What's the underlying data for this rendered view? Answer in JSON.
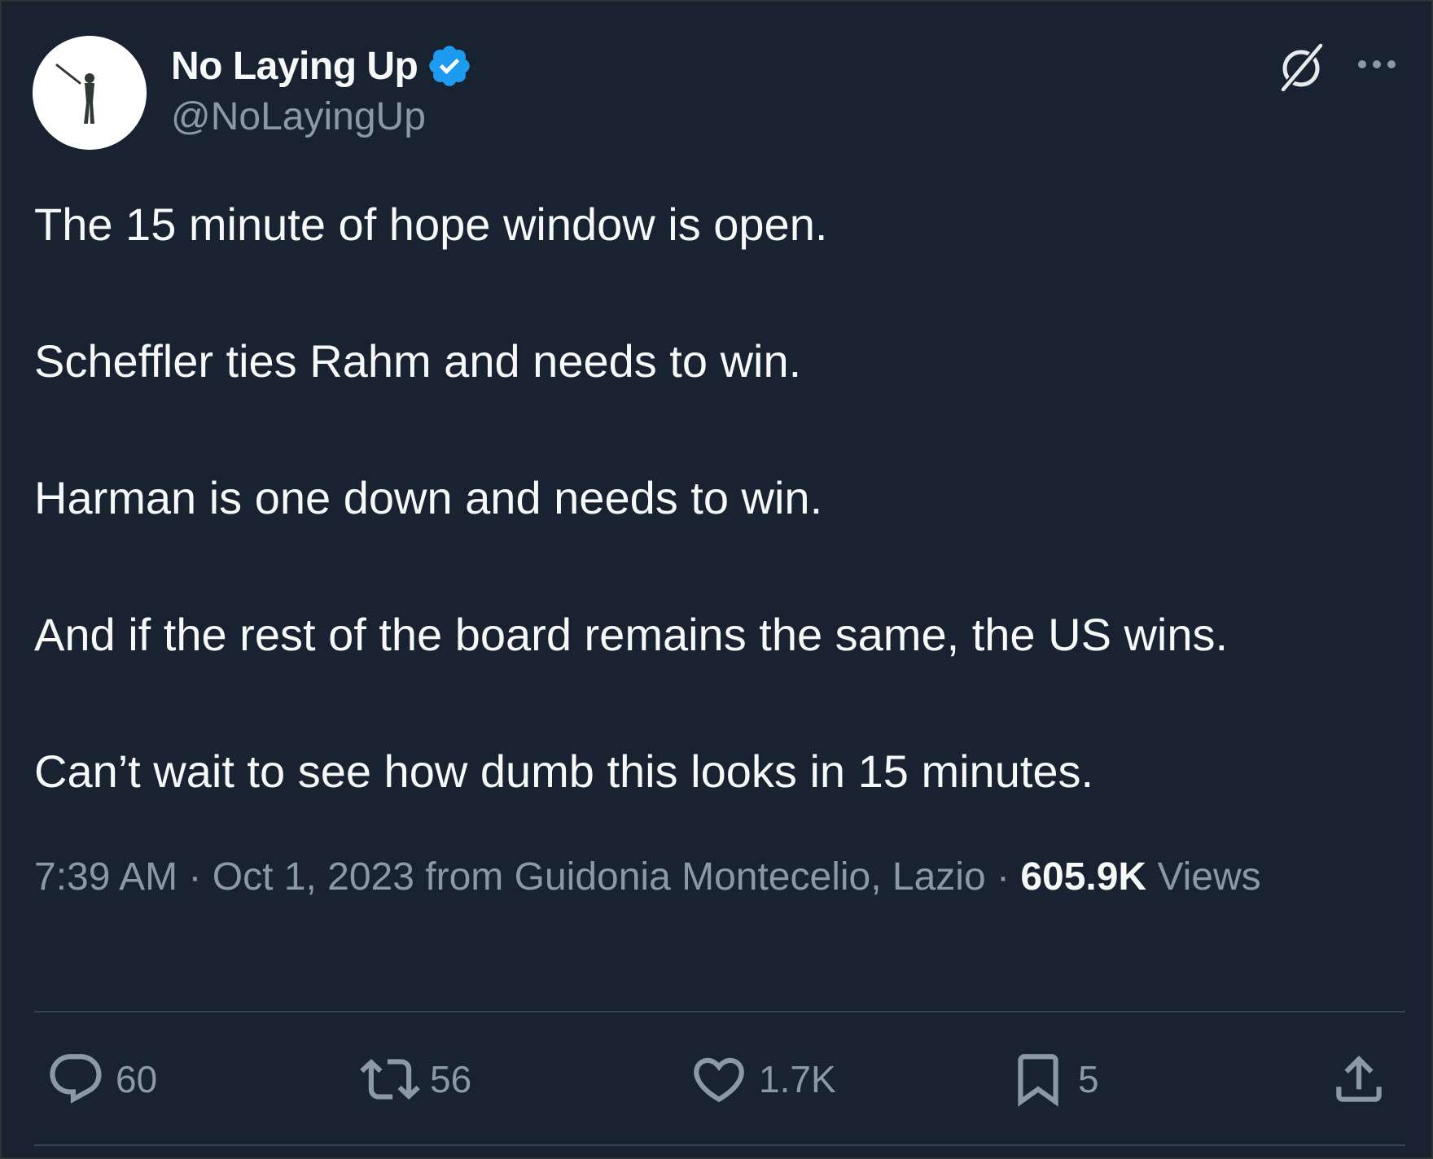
{
  "author": {
    "display_name": "No Laying Up",
    "handle": "@NoLayingUp",
    "verified": true,
    "verified_color": "#1d9bf0"
  },
  "tweet": {
    "paragraphs": [
      "The 15 minute of hope window is open.",
      "Scheffler ties Rahm and needs to win.",
      "Harman is one down and needs to win.",
      "And if the rest of the board remains the same, the US wins.",
      "Can’t wait to see how dumb this looks in 15 minutes."
    ]
  },
  "meta": {
    "time": "7:39 AM",
    "separator": "·",
    "date": "Oct 1, 2023",
    "location": "from Guidonia Montecelio, Lazio",
    "views_count": "605.9K",
    "views_label": "Views"
  },
  "actions": {
    "reply": {
      "icon": "reply-icon",
      "count": "60"
    },
    "retweet": {
      "icon": "retweet-icon",
      "count": "56"
    },
    "like": {
      "icon": "heart-icon",
      "count": "1.7K"
    },
    "bookmark": {
      "icon": "bookmark-icon",
      "count": "5"
    },
    "share": {
      "icon": "share-icon"
    }
  },
  "icons": {
    "header_right": [
      "grok-icon",
      "more-options-icon"
    ]
  },
  "colors": {
    "background": "#182230",
    "text_primary": "#f7f9f9",
    "text_secondary": "#8b98a5",
    "divider": "#38444d"
  }
}
